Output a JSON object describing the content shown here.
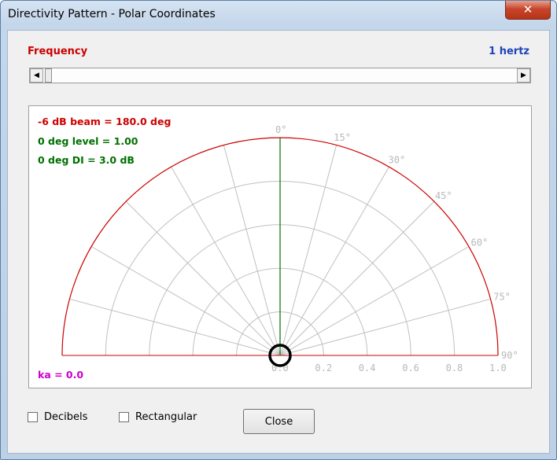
{
  "window": {
    "title": "Directivity Pattern - Polar Coordinates",
    "close_glyph": "✕"
  },
  "frequency": {
    "label": "Frequency",
    "value": "1 hertz"
  },
  "scrollbar": {
    "left_arrow": "◀",
    "right_arrow": "▶",
    "position_fraction": 0.0
  },
  "plot": {
    "beam": "-6 dB beam = 180.0 deg",
    "level": "0 deg level = 1.00",
    "di": "0 deg DI = 3.0 dB",
    "ka": "ka = 0.0",
    "angle_labels": [
      "0°",
      "15°",
      "30°",
      "45°",
      "60°",
      "75°",
      "90°"
    ],
    "angle_values_deg": [
      0,
      15,
      30,
      45,
      60,
      75,
      90
    ],
    "radial_labels": [
      "0.0",
      "0.2",
      "0.4",
      "0.6",
      "0.8",
      "1.0"
    ],
    "radial_values": [
      0.0,
      0.2,
      0.4,
      0.6,
      0.8,
      1.0
    ],
    "pattern_level": 1.0,
    "colors": {
      "pattern": "#cc0000",
      "axis_line": "#007000",
      "grid": "#c0c0c0",
      "labels": "#b8b8b8",
      "marker": "#000000"
    }
  },
  "options": {
    "decibels_label": "Decibels",
    "decibels_checked": false,
    "rectangular_label": "Rectangular",
    "rectangular_checked": false
  },
  "buttons": {
    "close_label": "Close"
  }
}
